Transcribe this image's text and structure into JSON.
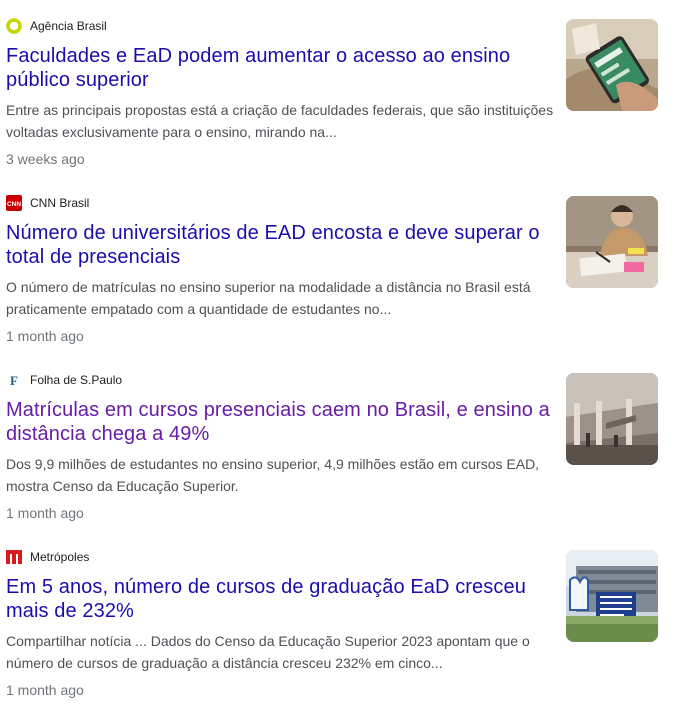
{
  "articles": [
    {
      "source": "Agência Brasil",
      "source_icon": "agencia-brasil-logo-icon",
      "title": "Faculdades e EaD podem aumentar o acesso ao ensino público superior",
      "snippet": "Entre as principais propostas está a criação de faculdades federais, que são instituições voltadas exclusivamente para o ensino, mirando na...",
      "time": "3 weeks ago",
      "visited": false,
      "thumbnail": "phone-in-hand-thumbnail"
    },
    {
      "source": "CNN Brasil",
      "source_icon": "cnn-logo-icon",
      "source_logo_text": "CNN",
      "title": "Número de universitários de EAD encosta e deve superar o total de presenciais",
      "snippet": "O número de matrículas no ensino superior na modalidade a distância no Brasil está praticamente empatado com a quantidade de estudantes no...",
      "time": "1 month ago",
      "visited": false,
      "thumbnail": "student-studying-thumbnail"
    },
    {
      "source": "Folha de S.Paulo",
      "source_icon": "folha-logo-icon",
      "source_logo_text": "F",
      "title": "Matrículas em cursos presenciais caem no Brasil, e ensino a distância chega a 49%",
      "snippet": "Dos 9,9 milhões de estudantes no ensino superior, 4,9 milhões estão em cursos EAD, mostra Censo da Educação Superior.",
      "time": "1 month ago",
      "visited": true,
      "thumbnail": "campus-building-thumbnail"
    },
    {
      "source": "Metrópoles",
      "source_icon": "metropoles-logo-icon",
      "title": "Em 5 anos, número de cursos de graduação EaD cresceu mais de 232%",
      "snippet": "Compartilhar notícia ... Dados do Censo da Educação Superior 2023 apontam que o número de cursos de graduação a distância cresceu 232% em cinco...",
      "time": "1 month ago",
      "visited": false,
      "thumbnail": "inep-building-thumbnail"
    }
  ],
  "colors": {
    "link": "#1a0dab",
    "visited_link": "#681da8",
    "snippet": "#4d5156",
    "time": "#70757a",
    "agencia_brasil": "#c6d600",
    "cnn": "#cc0000",
    "folha": "#1f5e8a",
    "metropoles": "#d71920"
  }
}
